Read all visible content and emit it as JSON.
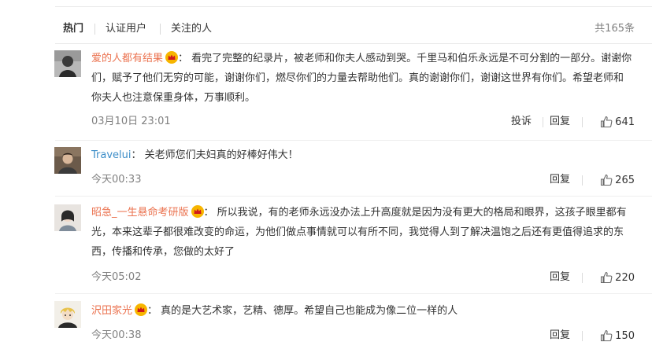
{
  "tabs": {
    "items": [
      {
        "label": "热门",
        "active": true
      },
      {
        "label": "认证用户",
        "active": false
      },
      {
        "label": "关注的人",
        "active": false
      }
    ],
    "count": "共165条"
  },
  "actions": {
    "report": "投诉",
    "reply": "回复"
  },
  "colors": {
    "username_orange": "#eb7350",
    "username_blue": "#3d8ec8",
    "meta_gray": "#808080",
    "badge": "#f7b500"
  },
  "comments": [
    {
      "username": "爱的人都有结果",
      "has_badge": true,
      "text": "看完了完整的纪录片，被老师和你夫人感动到哭。千里马和伯乐永远是不可分割的一部分。谢谢你们，赋予了他们无穷的可能，谢谢你们，燃尽你们的力量去帮助他们。真的谢谢你们，谢谢这世界有你们。希望老师和你夫人也注意保重身体，万事顺利。",
      "time": "03月10日 23:01",
      "has_report": true,
      "likes": "641"
    },
    {
      "username": "Travelui",
      "has_badge": false,
      "text": "关老师您们夫妇真的好棒好伟大！",
      "time": "今天00:33",
      "has_report": false,
      "likes": "265"
    },
    {
      "username": "昭急_一生悬命考研版",
      "has_badge": true,
      "text": "所以我说，有的老师永远没办法上升高度就是因为没有更大的格局和眼界，这孩子眼里都有光，本来这辈子都很难改变的命运，为他们做点事情就可以有所不同，我觉得人到了解决温饱之后还有更值得追求的东西，传播和传承，您做的太好了",
      "time": "今天05:02",
      "has_report": false,
      "likes": "220"
    },
    {
      "username": "沢田家光",
      "has_badge": true,
      "text": "真的是大艺术家，艺精、德厚。希望自己也能成为像二位一样的人",
      "time": "今天00:38",
      "has_report": false,
      "likes": "150"
    }
  ]
}
